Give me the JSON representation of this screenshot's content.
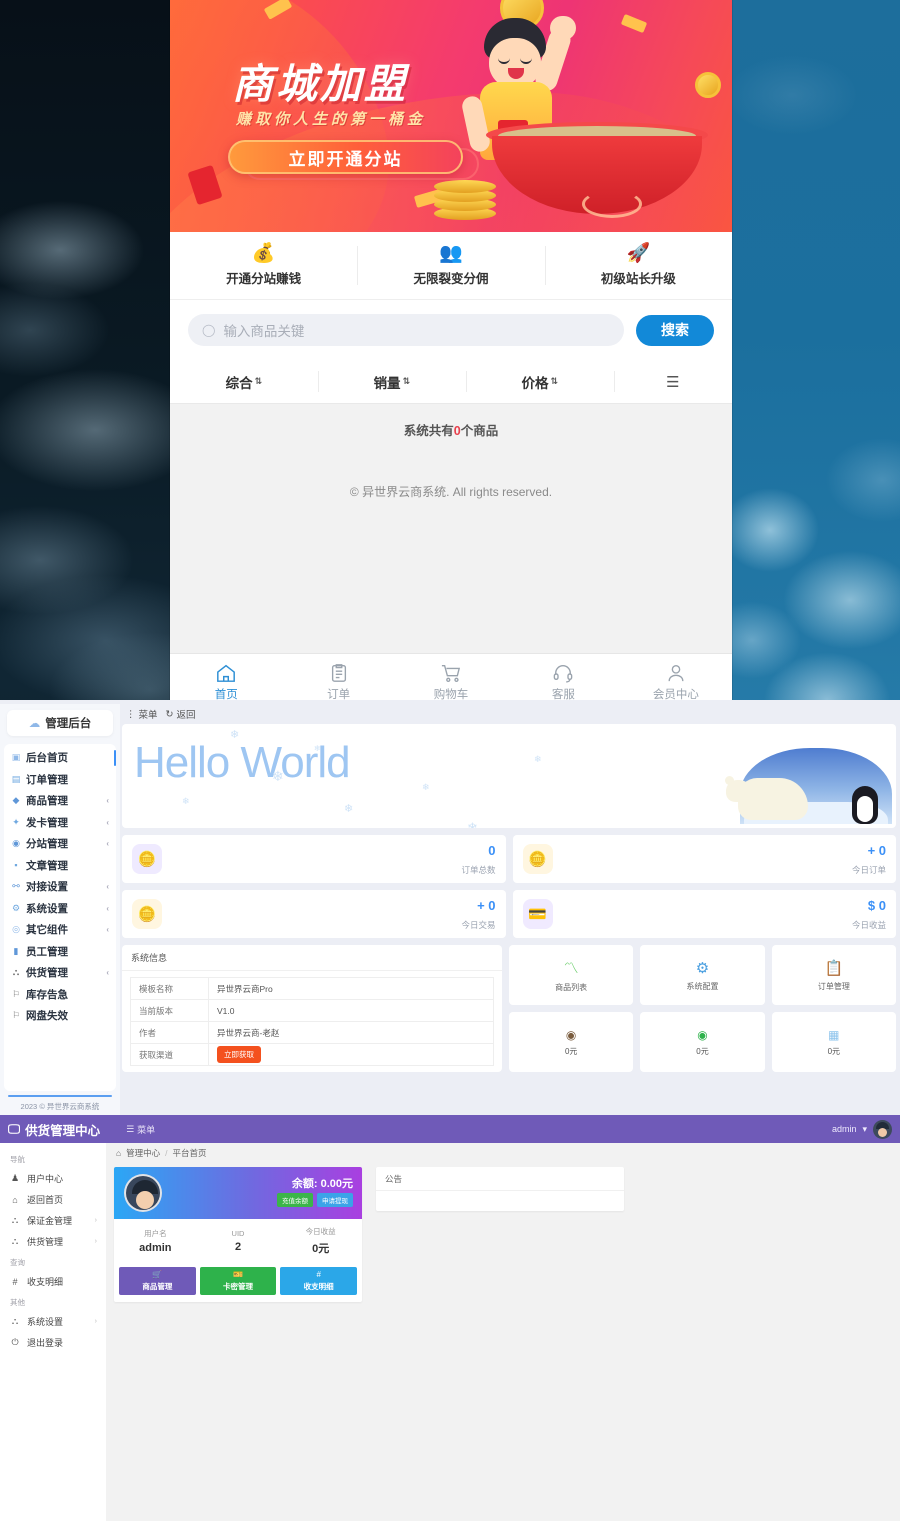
{
  "desktop": {
    "icons": [
      {
        "name": "file-explorer-icon",
        "glyph": "▤"
      },
      {
        "name": "media-player-icon",
        "glyph": "▶"
      }
    ]
  },
  "phone": {
    "banner": {
      "title": "商城加盟",
      "subtitle": "赚取你人生的第一桶金",
      "cta": "立即开通分站"
    },
    "features": [
      {
        "icon": "money-bag-icon",
        "glyph": "💰",
        "label": "开通分站赚钱"
      },
      {
        "icon": "users-group-icon",
        "glyph": "👥",
        "label": "无限裂变分佣"
      },
      {
        "icon": "rocket-icon",
        "glyph": "🚀",
        "label": "初级站长升级"
      }
    ],
    "search": {
      "placeholder": "输入商品关键",
      "value": "",
      "button": "搜索",
      "icon": "search-icon"
    },
    "sorts": [
      {
        "label": "综合",
        "caret": "⇅"
      },
      {
        "label": "销量",
        "caret": "⇅"
      },
      {
        "label": "价格",
        "caret": "⇅"
      }
    ],
    "list_view_icon": "list-view-icon",
    "product_count": {
      "prefix": "系统共有",
      "count": "0",
      "suffix": "个商品"
    },
    "copyright": "© 异世界云商系统. All rights reserved.",
    "tabs": [
      {
        "label": "首页",
        "icon": "home-icon",
        "active": true
      },
      {
        "label": "订单",
        "icon": "clipboard-icon",
        "active": false
      },
      {
        "label": "购物车",
        "icon": "cart-icon",
        "active": false
      },
      {
        "label": "客服",
        "icon": "headset-icon",
        "active": false
      },
      {
        "label": "会员中心",
        "icon": "user-icon",
        "active": false
      }
    ]
  },
  "admin": {
    "logo": "管理后台",
    "logo_icon": "cloud-icon",
    "menu": [
      {
        "label": "后台首页",
        "icon": "home-icon",
        "chevron": false,
        "active": true
      },
      {
        "label": "订单管理",
        "icon": "order-icon",
        "chevron": false,
        "active": false
      },
      {
        "label": "商品管理",
        "icon": "product-icon",
        "chevron": true,
        "active": false
      },
      {
        "label": "发卡管理",
        "icon": "card-icon",
        "chevron": true,
        "active": false
      },
      {
        "label": "分站管理",
        "icon": "site-icon",
        "chevron": true,
        "active": false
      },
      {
        "label": "文章管理",
        "icon": "article-icon",
        "chevron": false,
        "active": false
      },
      {
        "label": "对接设置",
        "icon": "link-icon",
        "chevron": true,
        "active": false
      },
      {
        "label": "系统设置",
        "icon": "gear-icon",
        "chevron": true,
        "active": false
      },
      {
        "label": "其它组件",
        "icon": "component-icon",
        "chevron": true,
        "active": false
      },
      {
        "label": "员工管理",
        "icon": "staff-icon",
        "chevron": false,
        "active": false
      },
      {
        "label": "供货管理",
        "icon": "supply-icon",
        "chevron": true,
        "active": false
      },
      {
        "label": "库存告急",
        "icon": "alert-icon",
        "chevron": false,
        "active": false
      },
      {
        "label": "网盘失效",
        "icon": "alert-icon",
        "chevron": false,
        "active": false
      }
    ],
    "footer": "2023 © 异世界云商系统",
    "topbar": {
      "menu": "菜单",
      "back": "返回",
      "menu_icon": "menu-icon",
      "back_icon": "refresh-icon"
    },
    "hero_text": "Hello World",
    "stats": [
      {
        "value": "0",
        "label": "订单总数",
        "icon": "coins-icon",
        "glyph": "🪙"
      },
      {
        "value": "+ 0",
        "label": "今日订单",
        "icon": "order-check-icon",
        "glyph": "🪙"
      },
      {
        "value": "+ 0",
        "label": "今日交易",
        "icon": "coin-icon",
        "glyph": "🪙"
      },
      {
        "value": "$ 0",
        "label": "今日收益",
        "icon": "wallet-icon",
        "glyph": "💳"
      }
    ],
    "sysinfo": {
      "title": "系统信息",
      "rows": [
        {
          "key": "模板名称",
          "value": "异世界云商Pro"
        },
        {
          "key": "当前版本",
          "value": "V1.0"
        },
        {
          "key": "作者",
          "value": "异世界云商-老赵"
        },
        {
          "key": "获取渠道",
          "value": ""
        }
      ],
      "get_button": "立即获取"
    },
    "shortcuts": [
      {
        "label": "商品列表",
        "icon": "pulse-icon",
        "glyph": "〽",
        "color": "#6fcf6f"
      },
      {
        "label": "系统配置",
        "icon": "sliders-icon",
        "glyph": "⚙",
        "color": "#4a9fe0"
      },
      {
        "label": "订单管理",
        "icon": "clipboard-icon",
        "glyph": "📋",
        "color": "#c9a5e8"
      }
    ],
    "pay_stats": [
      {
        "label": "0元",
        "icon": "alipay-icon",
        "glyph": "◉",
        "color": "#7a5c3e"
      },
      {
        "label": "0元",
        "icon": "wechat-pay-icon",
        "glyph": "◉",
        "color": "#2eb24b"
      },
      {
        "label": "0元",
        "icon": "qr-pay-icon",
        "glyph": "▦",
        "color": "#8ec4ec"
      }
    ]
  },
  "supply": {
    "brand": "供货管理中心",
    "brand_icon": "monitor-icon",
    "menu_label": "菜单",
    "menu_icon": "menu-icon",
    "user": "admin",
    "user_caret": "▾",
    "nav": [
      {
        "group": "导航",
        "items": [
          {
            "label": "用户中心",
            "icon": "user-icon",
            "chevron": false
          },
          {
            "label": "返回首页",
            "icon": "home-icon",
            "chevron": false
          },
          {
            "label": "保证金管理",
            "icon": "shield-icon",
            "chevron": true
          },
          {
            "label": "供货管理",
            "icon": "shield-icon",
            "chevron": true
          }
        ]
      },
      {
        "group": "查询",
        "items": [
          {
            "label": "收支明细",
            "icon": "hash-icon",
            "chevron": false
          }
        ]
      },
      {
        "group": "其他",
        "items": [
          {
            "label": "系统设置",
            "icon": "shield-icon",
            "chevron": true
          },
          {
            "label": "退出登录",
            "icon": "power-icon",
            "chevron": false
          }
        ]
      }
    ],
    "breadcrumb": {
      "home_icon": "home-icon",
      "home": "管理中心",
      "sep": "/",
      "current": "平台首页"
    },
    "card": {
      "avatar": "user-avatar",
      "balance": "余额: 0.00元",
      "recharge_button": "充值余额",
      "withdraw_button": "申请提现",
      "stats": [
        {
          "key": "用户名",
          "value": "admin"
        },
        {
          "key": "UID",
          "value": "2"
        },
        {
          "key": "今日收益",
          "value": "0元"
        }
      ],
      "actions": [
        {
          "label": "商品管理",
          "icon": "cart-icon",
          "glyph": "🛒"
        },
        {
          "label": "卡密管理",
          "icon": "card-icon",
          "glyph": "🎫"
        },
        {
          "label": "收支明细",
          "icon": "hash-icon",
          "glyph": "#"
        }
      ]
    },
    "notice": {
      "title": "公告",
      "body": ""
    }
  },
  "colors": {
    "accent_blue": "#1289d8",
    "purple": "#6f5ab8",
    "red": "#e8404c",
    "orange": "#f4511e",
    "green": "#2eb24b"
  }
}
